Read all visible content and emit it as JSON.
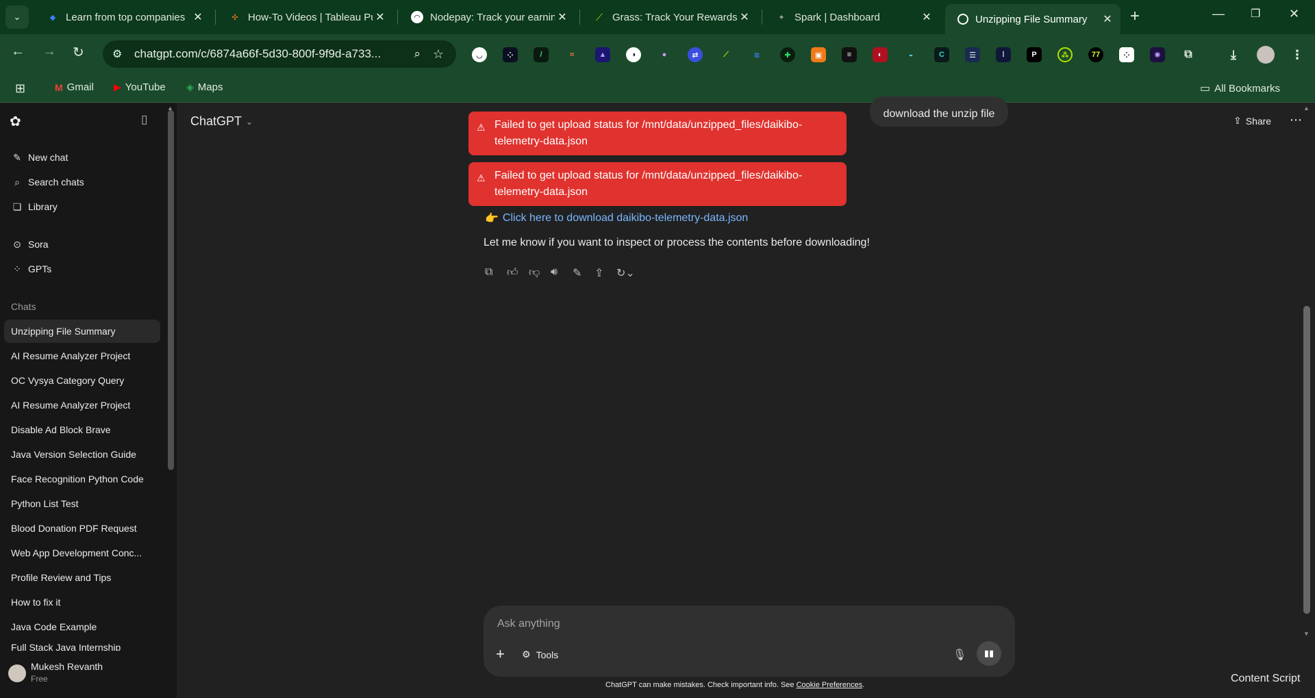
{
  "browser": {
    "tabs": [
      {
        "title": "Learn from top companies",
        "favicon_color": "#3b82f6"
      },
      {
        "title": "How-To Videos | Tableau Pub",
        "favicon_color": "#e97627"
      },
      {
        "title": "Nodepay: Track your earnings",
        "favicon_color": "#ffffff"
      },
      {
        "title": "Grass: Track Your Rewards",
        "favicon_color": "#b4e000"
      },
      {
        "title": "Spark | Dashboard",
        "favicon_color": "#9aa59a"
      },
      {
        "title": "Unzipping File Summary",
        "favicon_color": "#ffffff"
      }
    ],
    "url": "chatgpt.com/c/6874a66f-5d30-800f-9f9d-a733...",
    "bookmarks": [
      {
        "label": "Gmail"
      },
      {
        "label": "YouTube"
      },
      {
        "label": "Maps"
      }
    ],
    "all_bookmarks": "All Bookmarks"
  },
  "sidebar": {
    "actions": [
      {
        "label": "New chat",
        "icon": "edit-icon"
      },
      {
        "label": "Search chats",
        "icon": "search-icon"
      },
      {
        "label": "Library",
        "icon": "library-icon"
      }
    ],
    "apps": [
      {
        "label": "Sora",
        "icon": "play-circle-icon"
      },
      {
        "label": "GPTs",
        "icon": "grid-icon"
      }
    ],
    "section_label": "Chats",
    "chats": [
      "Unzipping File Summary",
      "AI Resume Analyzer Project",
      "OC Vysya Category Query",
      "AI Resume Analyzer Project",
      "Disable Ad Block Brave",
      "Java Version Selection Guide",
      "Face Recognition Python Code",
      "Python List Test",
      "Blood Donation PDF Request",
      "Web App Development Conc...",
      "Profile Review and Tips",
      "How to fix it",
      "Java Code Example",
      "Full Stack Java Internship"
    ],
    "user": {
      "name": "Mukesh Revanth",
      "plan": "Free"
    }
  },
  "header": {
    "model_label": "ChatGPT",
    "share_label": "Share"
  },
  "conversation": {
    "user_message": "download the unzip file",
    "errors": [
      {
        "line1": "Failed to get upload status for /mnt/data/unzipped_files/daikibo-",
        "line2": "telemetry-data.json"
      },
      {
        "line1": "Failed to get upload status for /mnt/data/unzipped_files/daikibo-",
        "line2": "telemetry-data.json"
      }
    ],
    "link_emoji": "👉",
    "link_text": "Click here to download daikibo-telemetry-data.json",
    "followup": "Let me know if you want to inspect or process the contents before downloading!"
  },
  "composer": {
    "placeholder": "Ask anything",
    "tools_label": "Tools"
  },
  "footer": {
    "disclaimer": "ChatGPT can make mistakes. Check important info. See ",
    "link": "Cookie Preferences",
    "end": "."
  },
  "overlay": {
    "content_script": "Content Script"
  }
}
